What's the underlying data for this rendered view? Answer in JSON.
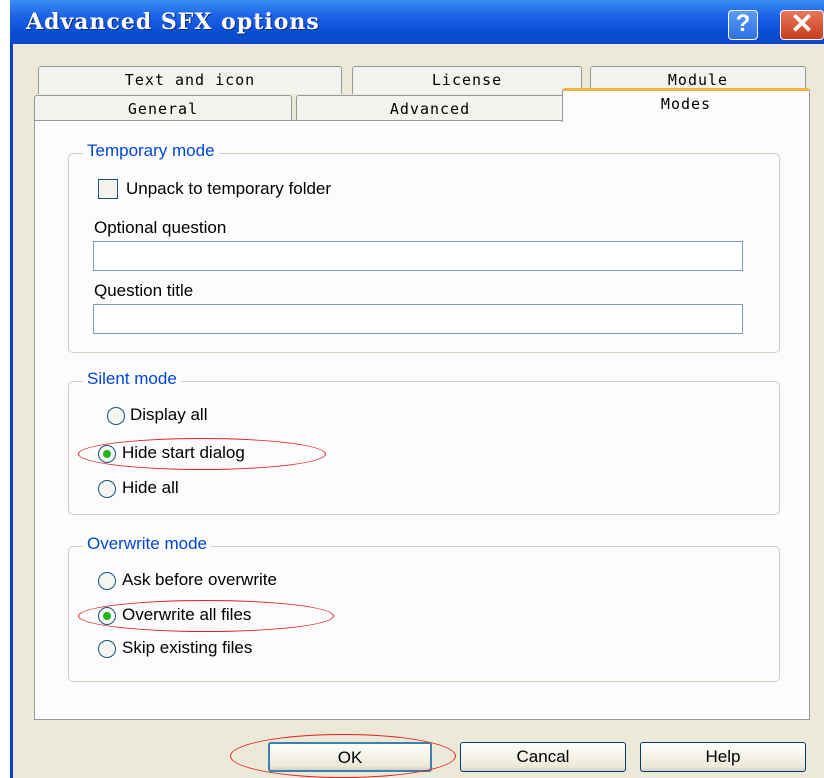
{
  "window": {
    "title": "Advanced SFX options",
    "help_glyph": "?",
    "close_glyph": "✕"
  },
  "tabs": {
    "row_back": [
      {
        "label": "Text and icon"
      },
      {
        "label": "License"
      },
      {
        "label": "Module"
      }
    ],
    "row_front": [
      {
        "label": "General"
      },
      {
        "label": "Advanced"
      },
      {
        "label": "Modes",
        "active": true
      }
    ]
  },
  "temporary_mode": {
    "legend": "Temporary mode",
    "unpack_label": "Unpack to temporary folder",
    "unpack_checked": false,
    "question_label": "Optional question",
    "question_value": "",
    "title_label": "Question title",
    "title_value": ""
  },
  "silent_mode": {
    "legend": "Silent mode",
    "options": [
      {
        "label": "Display all",
        "selected": false
      },
      {
        "label": "Hide start dialog",
        "selected": true
      },
      {
        "label": "Hide all",
        "selected": false
      }
    ]
  },
  "overwrite_mode": {
    "legend": "Overwrite mode",
    "options": [
      {
        "label": "Ask before overwrite",
        "selected": false
      },
      {
        "label": "Overwrite all files",
        "selected": true
      },
      {
        "label": "Skip existing files",
        "selected": false
      }
    ]
  },
  "buttons": {
    "ok": "OK",
    "cancel": "Cancal",
    "help": "Help"
  },
  "colors": {
    "titlebar": "#0a4fd6",
    "group_legend": "#0046d5",
    "active_tab_accent": "#f7b045",
    "radio_selected": "#22b222",
    "annotation": "#e02020"
  }
}
